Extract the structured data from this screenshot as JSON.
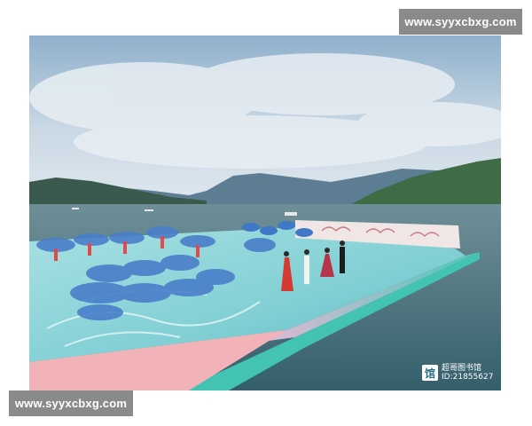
{
  "watermark": {
    "top_text": "www.syyxcbxg.com",
    "bottom_text": "www.syyxcbxg.com"
  },
  "photo": {
    "subject": "floating-stage-performance-on-lake",
    "credit": {
      "logo_icon": "library-logo-icon",
      "name": "超哥图书馆",
      "id": "ID:21855627"
    }
  },
  "colors": {
    "watermark_bg": "#8a8a8a",
    "water": "#3f6f78",
    "sky": "#a9c2d6",
    "stage_floor": "#8fd0d6",
    "stage_edge": "#3ec7b4"
  }
}
